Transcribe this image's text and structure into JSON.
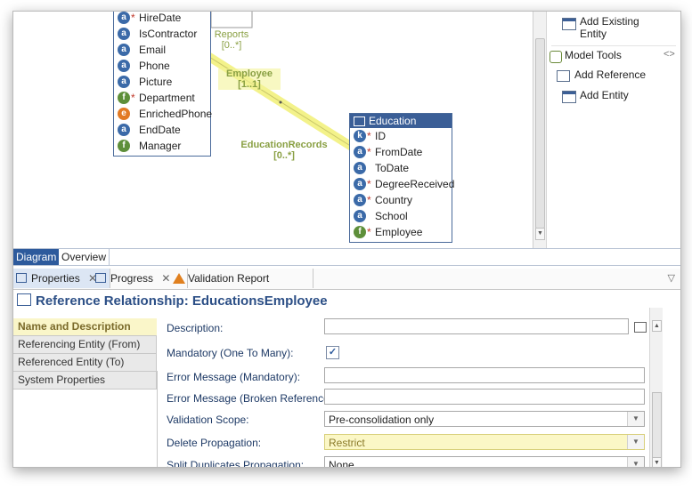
{
  "diagram": {
    "employee_attrs": [
      {
        "icon": "a",
        "required": true,
        "label": "HireDate"
      },
      {
        "icon": "a",
        "required": false,
        "label": "IsContractor"
      },
      {
        "icon": "a",
        "required": false,
        "label": "Email"
      },
      {
        "icon": "a",
        "required": false,
        "label": "Phone"
      },
      {
        "icon": "a",
        "required": false,
        "label": "Picture"
      },
      {
        "icon": "f",
        "required": true,
        "label": "Department"
      },
      {
        "icon": "e",
        "required": false,
        "label": "EnrichedPhone"
      },
      {
        "icon": "a",
        "required": false,
        "label": "EndDate"
      },
      {
        "icon": "f",
        "required": false,
        "label": "Manager"
      }
    ],
    "education": {
      "title": "Education",
      "attrs": [
        {
          "icon": "k",
          "required": true,
          "label": "ID"
        },
        {
          "icon": "a",
          "required": true,
          "label": "FromDate"
        },
        {
          "icon": "a",
          "required": false,
          "label": "ToDate"
        },
        {
          "icon": "a",
          "required": true,
          "label": "DegreeReceived"
        },
        {
          "icon": "a",
          "required": true,
          "label": "Country"
        },
        {
          "icon": "a",
          "required": false,
          "label": "School"
        },
        {
          "icon": "f",
          "required": true,
          "label": "Employee"
        }
      ]
    },
    "labels": {
      "reports": "Reports",
      "reports_card": "[0..*]",
      "employee": "Employee",
      "employee_card": "[1..1]",
      "edu_records": "EducationRecords",
      "edu_records_card": "[0..*]"
    },
    "icon_letters": {
      "a": "a",
      "f": "f",
      "e": "e",
      "k": "k"
    }
  },
  "palette": {
    "add_existing": "Add Existing Entity",
    "model_tools": "Model Tools",
    "model_tools_toggle": "<>",
    "add_reference": "Add Reference",
    "add_entity": "Add Entity"
  },
  "diagram_tabs": {
    "diagram": "Diagram",
    "overview": "Overview"
  },
  "view_tabs": {
    "properties": "Properties",
    "progress": "Progress",
    "validation": "Validation Report",
    "close_symbol": "✕"
  },
  "properties": {
    "title": "Reference Relationship: EducationsEmployee",
    "sections": [
      "Name and Description",
      "Referencing Entity (From)",
      "Referenced Entity (To)",
      "System Properties"
    ],
    "fields": {
      "description_label": "Description:",
      "description_value": "",
      "mandatory_label": "Mandatory (One To Many):",
      "mandatory_checked": "✓",
      "err_mandatory_label": "Error Message (Mandatory):",
      "err_mandatory_value": "",
      "err_broken_label": "Error Message (Broken Reference):",
      "err_broken_value": "",
      "validation_scope_label": "Validation Scope:",
      "validation_scope_value": "Pre-consolidation only",
      "delete_prop_label": "Delete Propagation:",
      "delete_prop_value": "Restrict",
      "split_dup_label": "Split Duplicates Propagation:",
      "split_dup_value": "None"
    }
  },
  "colors": {
    "accent": "#2d5a9c",
    "highlight": "#fbf7c6",
    "connector": "#f4f39a"
  }
}
